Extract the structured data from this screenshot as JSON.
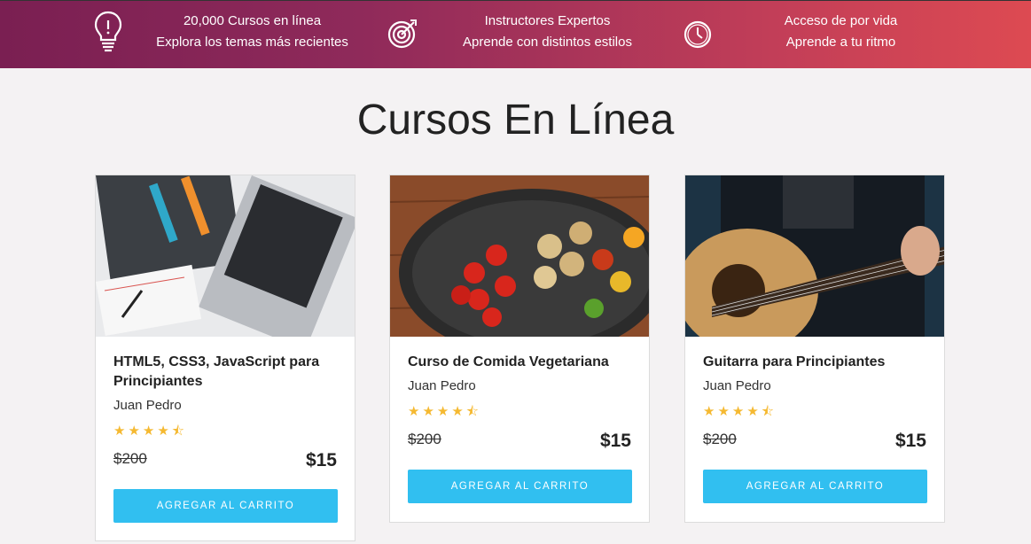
{
  "features": [
    {
      "icon": "lightbulb-icon",
      "line1": "20,000 Cursos en línea",
      "line2": "Explora los temas más recientes"
    },
    {
      "icon": "target-icon",
      "line1": "Instructores Expertos",
      "line2": "Aprende con distintos estilos"
    },
    {
      "icon": "clock-icon",
      "line1": "Acceso de por vida",
      "line2": "Aprende a tu ritmo"
    }
  ],
  "page_title": "Cursos En Línea",
  "courses": [
    {
      "title": "HTML5, CSS3, JavaScript para Principiantes",
      "author": "Juan Pedro",
      "rating": 4.5,
      "old_price": "$200",
      "price": "$15",
      "button": "AGREGAR AL CARRITO",
      "image": "laptop-book-image"
    },
    {
      "title": "Curso de Comida Vegetariana",
      "author": "Juan Pedro",
      "rating": 4.5,
      "old_price": "$200",
      "price": "$15",
      "button": "AGREGAR AL CARRITO",
      "image": "vegetable-pan-image"
    },
    {
      "title": "Guitarra para Principiantes",
      "author": "Juan Pedro",
      "rating": 4.5,
      "old_price": "$200",
      "price": "$15",
      "button": "AGREGAR AL CARRITO",
      "image": "guitar-player-image"
    }
  ],
  "star_glyphs": "★★★★⯪",
  "colors": {
    "accent": "#31bff0",
    "star": "#f5b931",
    "banner_start": "#7a1f52",
    "banner_end": "#dd4a52"
  }
}
